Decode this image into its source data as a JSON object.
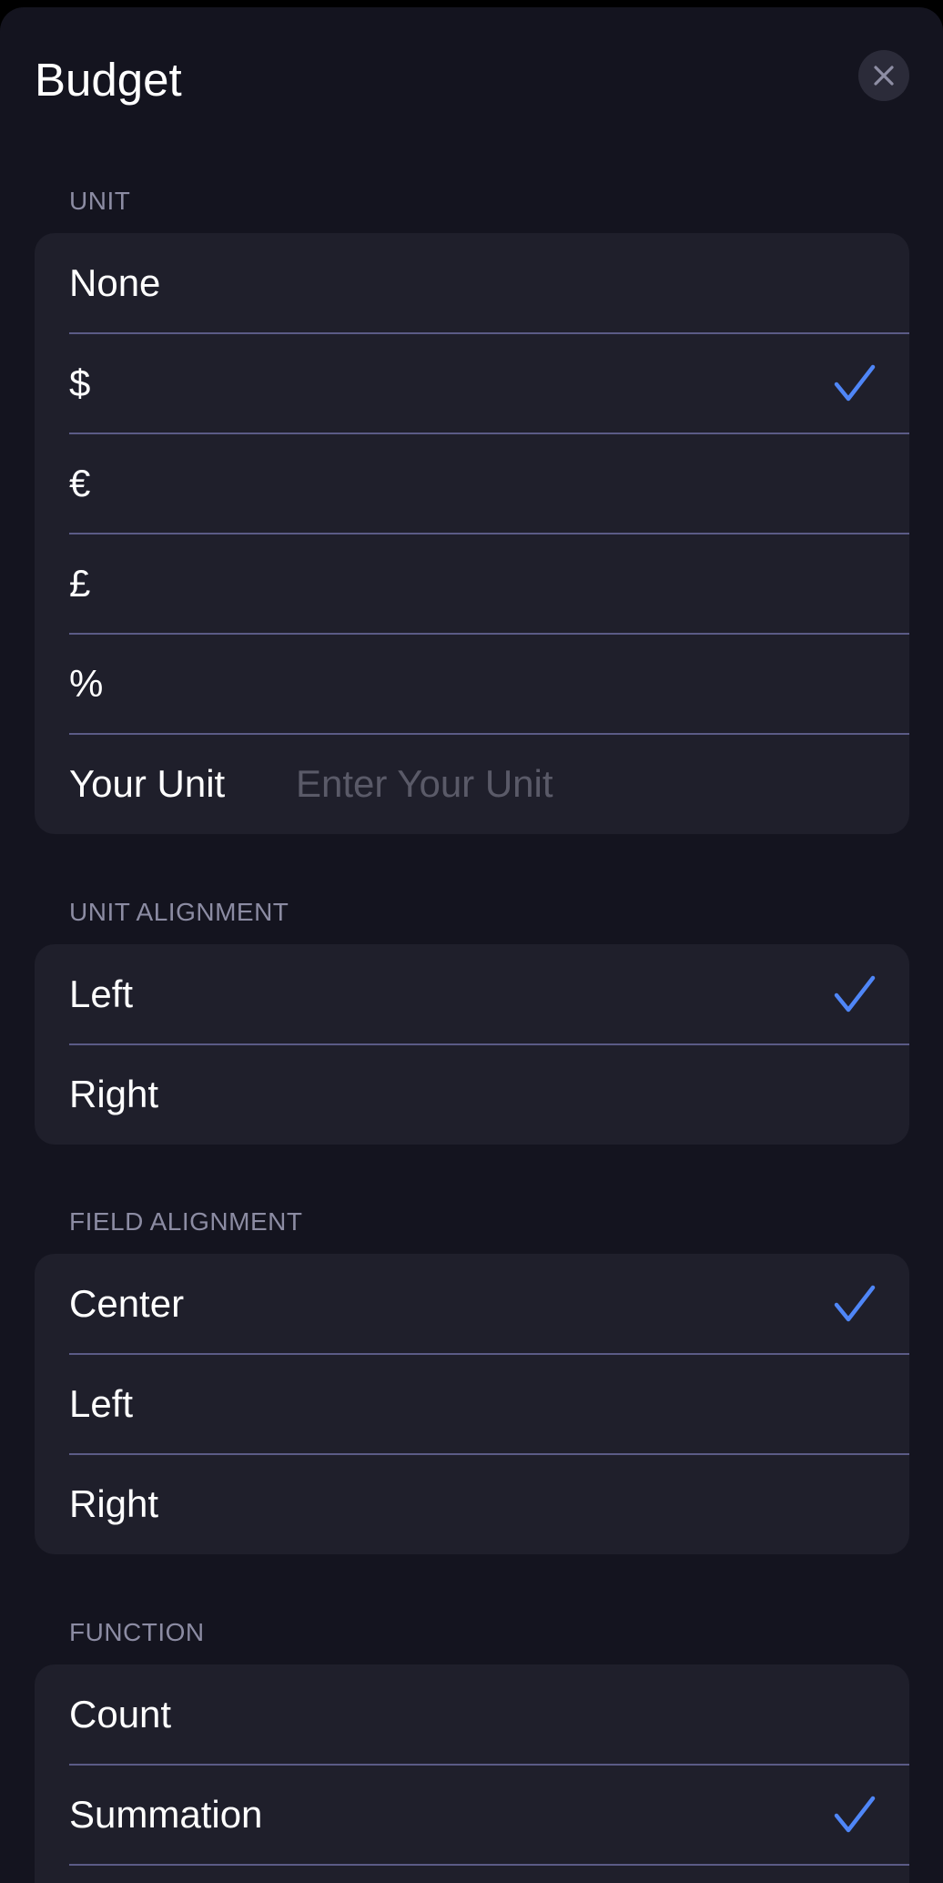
{
  "header": {
    "title": "Budget",
    "close_icon": "close-icon"
  },
  "accent_color": "#4f86f7",
  "sections": {
    "unit": {
      "label": "UNIT",
      "options": [
        {
          "label": "None",
          "selected": false
        },
        {
          "label": "$",
          "selected": true
        },
        {
          "label": "€",
          "selected": false
        },
        {
          "label": "£",
          "selected": false
        },
        {
          "label": "%",
          "selected": false
        }
      ],
      "custom": {
        "label": "Your Unit",
        "value": "",
        "placeholder": "Enter Your Unit"
      }
    },
    "unit_alignment": {
      "label": "UNIT ALIGNMENT",
      "options": [
        {
          "label": "Left",
          "selected": true
        },
        {
          "label": "Right",
          "selected": false
        }
      ]
    },
    "field_alignment": {
      "label": "FIELD ALIGNMENT",
      "options": [
        {
          "label": "Center",
          "selected": true
        },
        {
          "label": "Left",
          "selected": false
        },
        {
          "label": "Right",
          "selected": false
        }
      ]
    },
    "function": {
      "label": "FUNCTION",
      "options": [
        {
          "label": "Count",
          "selected": false
        },
        {
          "label": "Summation",
          "selected": true
        }
      ]
    }
  }
}
